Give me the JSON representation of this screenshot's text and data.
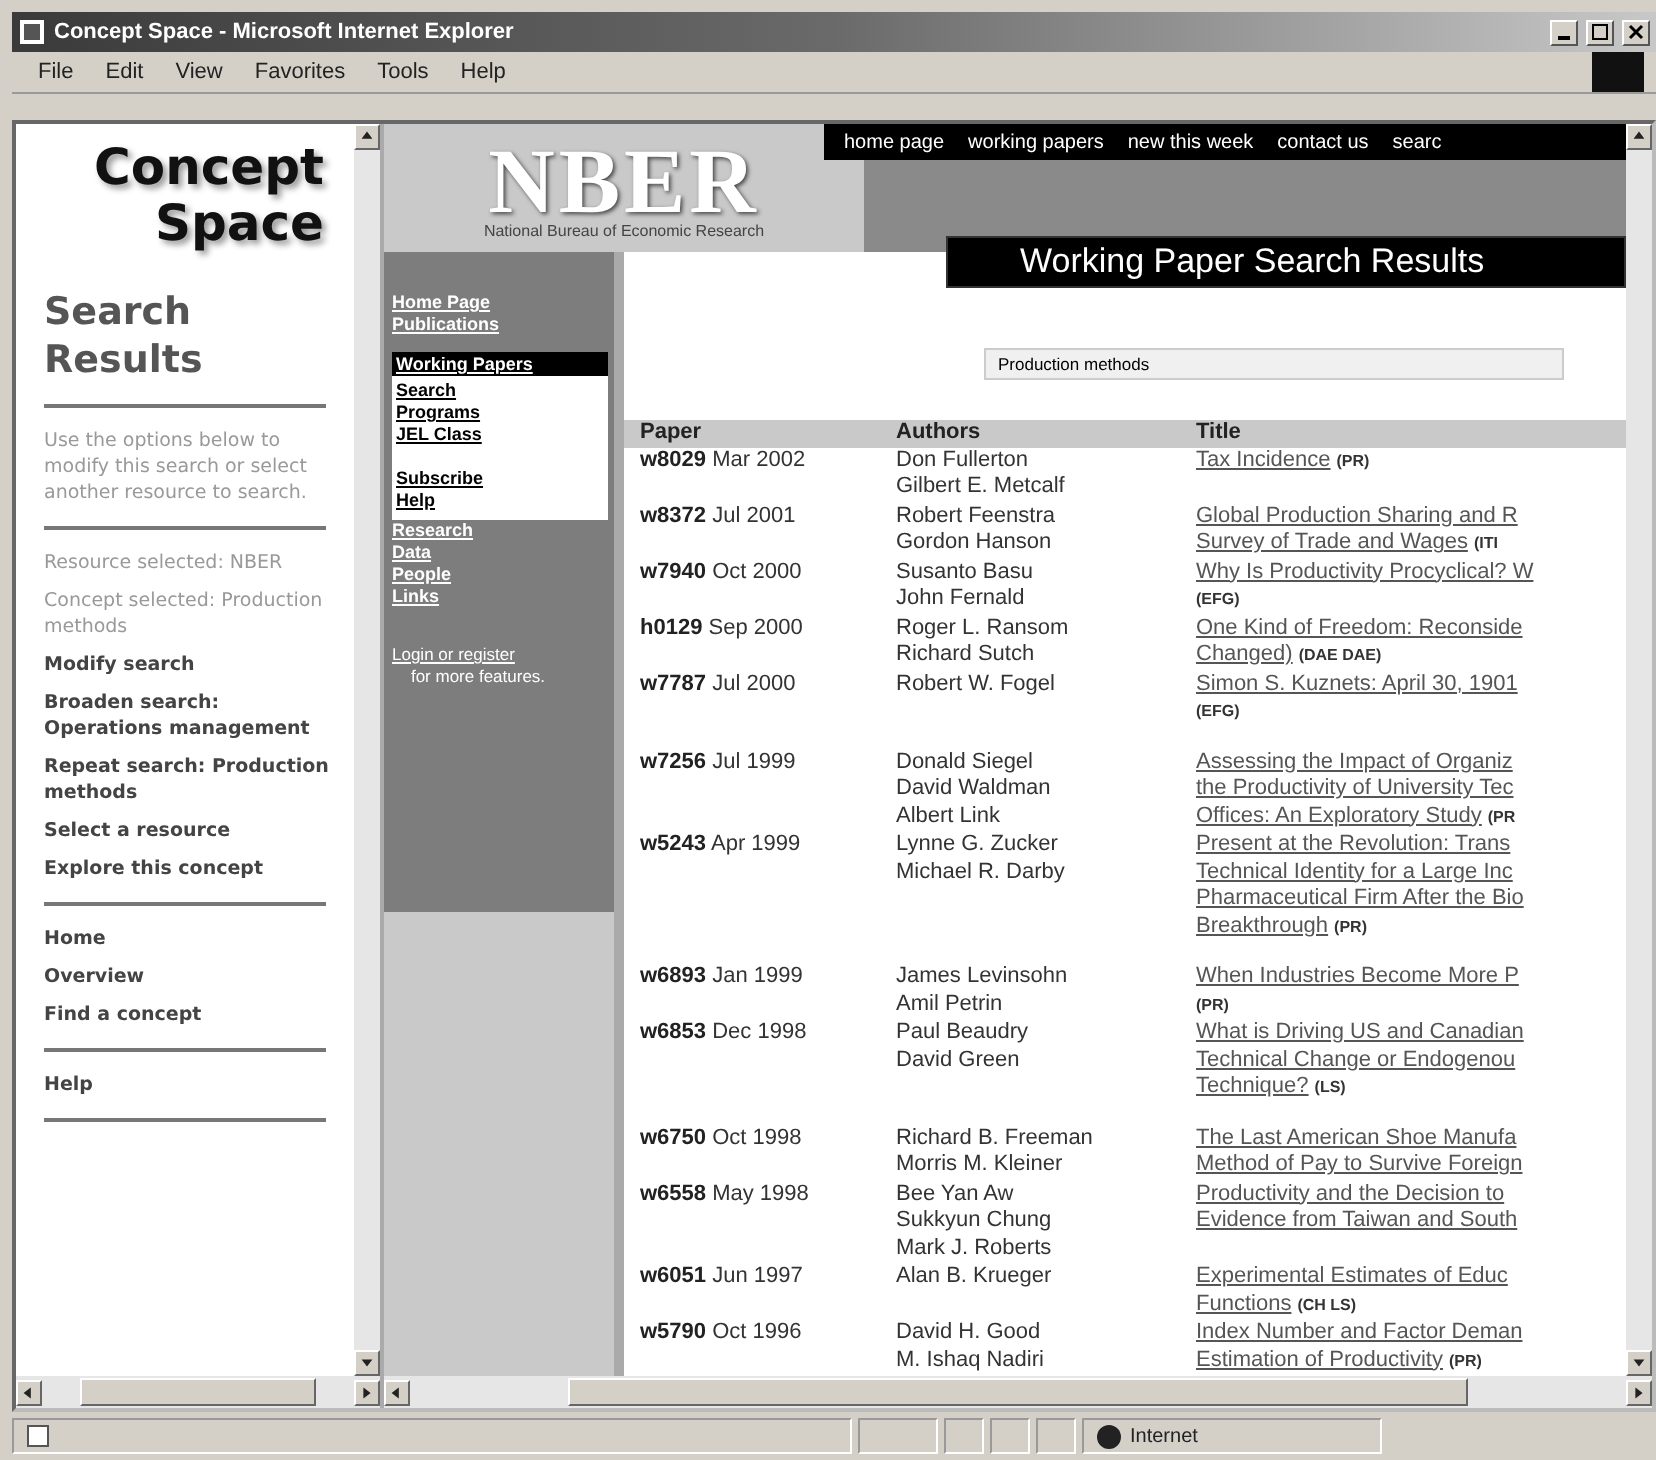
{
  "window": {
    "title": "Concept Space - Microsoft Internet Explorer"
  },
  "menu": [
    "File",
    "Edit",
    "View",
    "Favorites",
    "Tools",
    "Help"
  ],
  "concept_space": {
    "logo": [
      "Concept",
      "Space"
    ],
    "heading": "Search Results",
    "intro": "Use the options below to modify this search or select another resource to search.",
    "info": [
      "Resource selected: NBER",
      "Concept selected: Production methods"
    ],
    "actions": [
      "Modify search",
      "Broaden search: Operations management",
      "Repeat search: Production methods",
      "Select a resource",
      "Explore this concept"
    ],
    "nav": [
      "Home",
      "Overview",
      "Find a concept"
    ],
    "help": "Help"
  },
  "nber": {
    "logo": "NBER",
    "subtitle": "National Bureau of Economic Research",
    "top_nav": [
      "home page",
      "working papers",
      "new this week",
      "contact us",
      "searc"
    ],
    "side_links": [
      "Home Page",
      "Publications"
    ],
    "submenu": {
      "title": "Working Papers",
      "items": [
        {
          "label": "Search",
          "spaced_above": false
        },
        {
          "label": "Programs",
          "spaced_above": false
        },
        {
          "label": "JEL Class",
          "spaced_above": false
        },
        {
          "label": "Subscribe",
          "spaced_above": true
        },
        {
          "label": "Help",
          "spaced_above": false
        }
      ]
    },
    "more_links": [
      "Research",
      "Data",
      "People",
      "Links"
    ],
    "login": {
      "link": "Login or register",
      "text": "for more features."
    },
    "heading": "Working Paper Search Results",
    "search_value": "Production methods",
    "columns": [
      "Paper",
      "Authors",
      "Title"
    ],
    "rows": [
      {
        "paper": "w8029",
        "date": "Mar 2002",
        "authors": [
          "Don Fullerton",
          "Gilbert E. Metcalf"
        ],
        "title": [
          "Tax Incidence"
        ],
        "tag": "(PR)",
        "tag_own_line": false
      },
      {
        "paper": "w8372",
        "date": "Jul 2001",
        "authors": [
          "Robert Feenstra",
          "Gordon Hanson"
        ],
        "title": [
          "Global Production Sharing and R",
          "Survey of Trade and Wages"
        ],
        "tag": "(ITI",
        "tag_own_line": false
      },
      {
        "paper": "w7940",
        "date": "Oct 2000",
        "authors": [
          "Susanto Basu",
          "John Fernald"
        ],
        "title": [
          "Why Is Productivity Procyclical? W"
        ],
        "tag": "(EFG)",
        "tag_own_line": true
      },
      {
        "paper": "h0129",
        "date": "Sep 2000",
        "authors": [
          "Roger L. Ransom",
          "Richard Sutch"
        ],
        "title": [
          "One Kind of Freedom: Reconside",
          "Changed)"
        ],
        "tag": "(DAE DAE)",
        "tag_own_line": false
      },
      {
        "paper": "w7787",
        "date": "Jul 2000",
        "authors": [
          "Robert W. Fogel"
        ],
        "title": [
          "Simon S. Kuznets: April 30, 1901"
        ],
        "tag": "(EFG)",
        "tag_own_line": true
      },
      {
        "paper": "w7256",
        "date": "Jul 1999",
        "authors": [
          "Donald Siegel",
          "David Waldman",
          "Albert Link"
        ],
        "title": [
          "Assessing the Impact of Organiz",
          "the Productivity of University Tec",
          "Offices: An Exploratory Study"
        ],
        "tag": "(PR",
        "tag_own_line": false
      },
      {
        "paper": "w5243",
        "date": "Apr 1999",
        "authors": [
          "Lynne G. Zucker",
          "Michael R. Darby"
        ],
        "title": [
          "Present at the Revolution: Trans",
          "Technical Identity for a Large Inc",
          "Pharmaceutical Firm After the Bio",
          "Breakthrough"
        ],
        "tag": "(PR)",
        "tag_own_line": false
      },
      {
        "paper": "w6893",
        "date": "Jan 1999",
        "authors": [
          "James Levinsohn",
          "Amil Petrin"
        ],
        "title": [
          "When Industries Become More P"
        ],
        "tag": "(PR)",
        "tag_own_line": true
      },
      {
        "paper": "w6853",
        "date": "Dec 1998",
        "authors": [
          "Paul Beaudry",
          "David Green"
        ],
        "title": [
          "What is Driving US and Canadian",
          "Technical Change or Endogenou",
          "Technique?"
        ],
        "tag": "(LS)",
        "tag_own_line": false
      },
      {
        "paper": "w6750",
        "date": "Oct 1998",
        "authors": [
          "Richard B. Freeman",
          "Morris M. Kleiner"
        ],
        "title": [
          "The Last American Shoe Manufa",
          "Method of Pay to Survive Foreign"
        ]
      },
      {
        "paper": "w6558",
        "date": "May 1998",
        "authors": [
          "Bee Yan Aw",
          "Sukkyun Chung",
          "Mark J. Roberts"
        ],
        "title": [
          "Productivity and the Decision to",
          "Evidence from Taiwan and South"
        ]
      },
      {
        "paper": "w6051",
        "date": "Jun 1997",
        "authors": [
          "Alan B. Krueger"
        ],
        "title": [
          "Experimental Estimates of Educ",
          "Functions"
        ],
        "tag": "(CH LS)",
        "tag_own_line": false
      },
      {
        "paper": "w5790",
        "date": "Oct 1996",
        "authors": [
          "David H. Good",
          "M. Ishaq Nadiri"
        ],
        "title": [
          "Index Number and Factor Deman",
          "Estimation of Productivity"
        ],
        "tag": "(PR)",
        "tag_own_line": false
      }
    ]
  },
  "status_bar": {
    "zone": "Internet"
  }
}
